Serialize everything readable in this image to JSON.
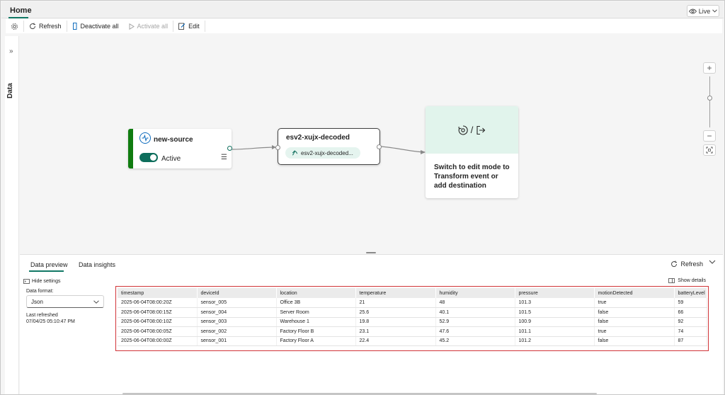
{
  "tabs": {
    "home": "Home"
  },
  "live_button": {
    "label": "Live"
  },
  "toolbar": {
    "refresh": "Refresh",
    "deactivate_all": "Deactivate all",
    "activate_all": "Activate all",
    "edit": "Edit"
  },
  "rail": {
    "label": "Data"
  },
  "canvas": {
    "source": {
      "name": "new-source",
      "status": "Active"
    },
    "stream": {
      "name": "esv2-xujx-decoded",
      "pill": "esv2-xujx-decoded..."
    },
    "destination": {
      "icons_sep": "/",
      "text": "Switch to edit mode to Transform event or add destination"
    }
  },
  "panel": {
    "tab_preview": "Data preview",
    "tab_insights": "Data insights",
    "refresh": "Refresh",
    "hide_settings": "Hide settings",
    "show_details": "Show details",
    "format_label": "Data format:",
    "format_value": "Json",
    "last_refreshed_label": "Last refreshed",
    "last_refreshed_value": "07/04/25 05:10:47 PM"
  },
  "table": {
    "columns": [
      "timestamp",
      "deviceId",
      "location",
      "temperature",
      "humidity",
      "pressure",
      "motionDetected",
      "batteryLevel"
    ],
    "rows": [
      [
        "2025-06-04T08:00:20Z",
        "sensor_005",
        "Office 3B",
        "21",
        "48",
        "101.3",
        "true",
        "59"
      ],
      [
        "2025-06-04T08:00:15Z",
        "sensor_004",
        "Server Room",
        "25.6",
        "40.1",
        "101.5",
        "false",
        "66"
      ],
      [
        "2025-06-04T08:00:10Z",
        "sensor_003",
        "Warehouse 1",
        "19.8",
        "52.9",
        "100.9",
        "false",
        "92"
      ],
      [
        "2025-06-04T08:00:05Z",
        "sensor_002",
        "Factory Floor B",
        "23.1",
        "47.6",
        "101.1",
        "true",
        "74"
      ],
      [
        "2025-06-04T08:00:00Z",
        "sensor_001",
        "Factory Floor A",
        "22.4",
        "45.2",
        "101.2",
        "false",
        "87"
      ]
    ]
  },
  "colors": {
    "accent": "#117865",
    "source_bar": "#107c10",
    "highlight_border": "#d13438",
    "dest_fill": "#e1f4ec"
  }
}
